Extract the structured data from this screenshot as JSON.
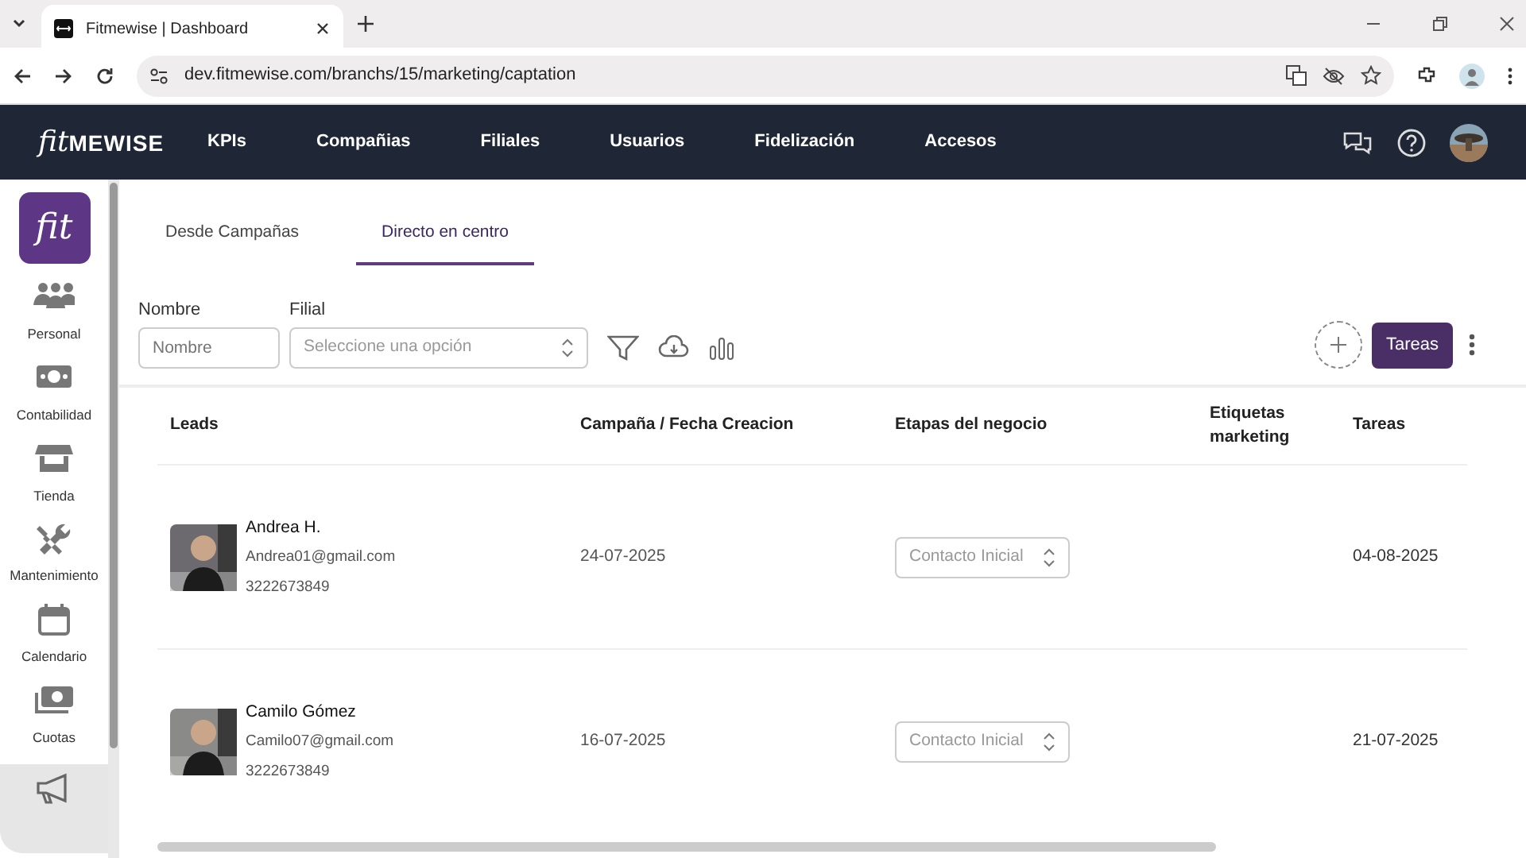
{
  "browser": {
    "tab_title": "Fitmewise | Dashboard",
    "url": "dev.fitmewise.com/branchs/15/marketing/captation"
  },
  "navbar": {
    "logo_script": "fit",
    "logo_text": "MEWISE",
    "items": [
      {
        "label": "KPIs"
      },
      {
        "label": "Compañias"
      },
      {
        "label": "Filiales"
      },
      {
        "label": "Usuarios"
      },
      {
        "label": "Fidelización"
      },
      {
        "label": "Accesos"
      }
    ]
  },
  "sidebar": {
    "logo": "fit",
    "items": [
      {
        "label": "Personal",
        "selected": false
      },
      {
        "label": "Contabilidad",
        "selected": false
      },
      {
        "label": "Tienda",
        "selected": false
      },
      {
        "label": "Mantenimiento",
        "selected": false
      },
      {
        "label": "Calendario",
        "selected": false
      },
      {
        "label": "Cuotas",
        "selected": false
      },
      {
        "selected": true
      }
    ]
  },
  "tabs": [
    {
      "label": "Desde Campañas",
      "selected": false
    },
    {
      "label": "Directo en centro",
      "selected": true
    }
  ],
  "filters": [
    {
      "kind": "text",
      "label": "Nombre",
      "placeholder": "Nombre"
    },
    {
      "kind": "select",
      "label": "Filial",
      "placeholder": "Seleccione una opción"
    }
  ],
  "tasks_button": "Tareas",
  "table": {
    "columns": [
      "Leads",
      "Campaña / Fecha Creacion",
      "Etapas del negocio",
      "Etiquetas marketing",
      "Tareas"
    ],
    "rows": [
      {
        "name": "Andrea H.",
        "email": "Andrea01@gmail.com",
        "phone": "3222673849",
        "created": "24-07-2025",
        "stage": "Contacto Inicial",
        "task_date": "04-08-2025"
      },
      {
        "name": "Camilo Gómez",
        "email": "Camilo07@gmail.com",
        "phone": "3222673849",
        "created": "16-07-2025",
        "stage": "Contacto Inicial",
        "task_date": "21-07-2025"
      }
    ]
  }
}
